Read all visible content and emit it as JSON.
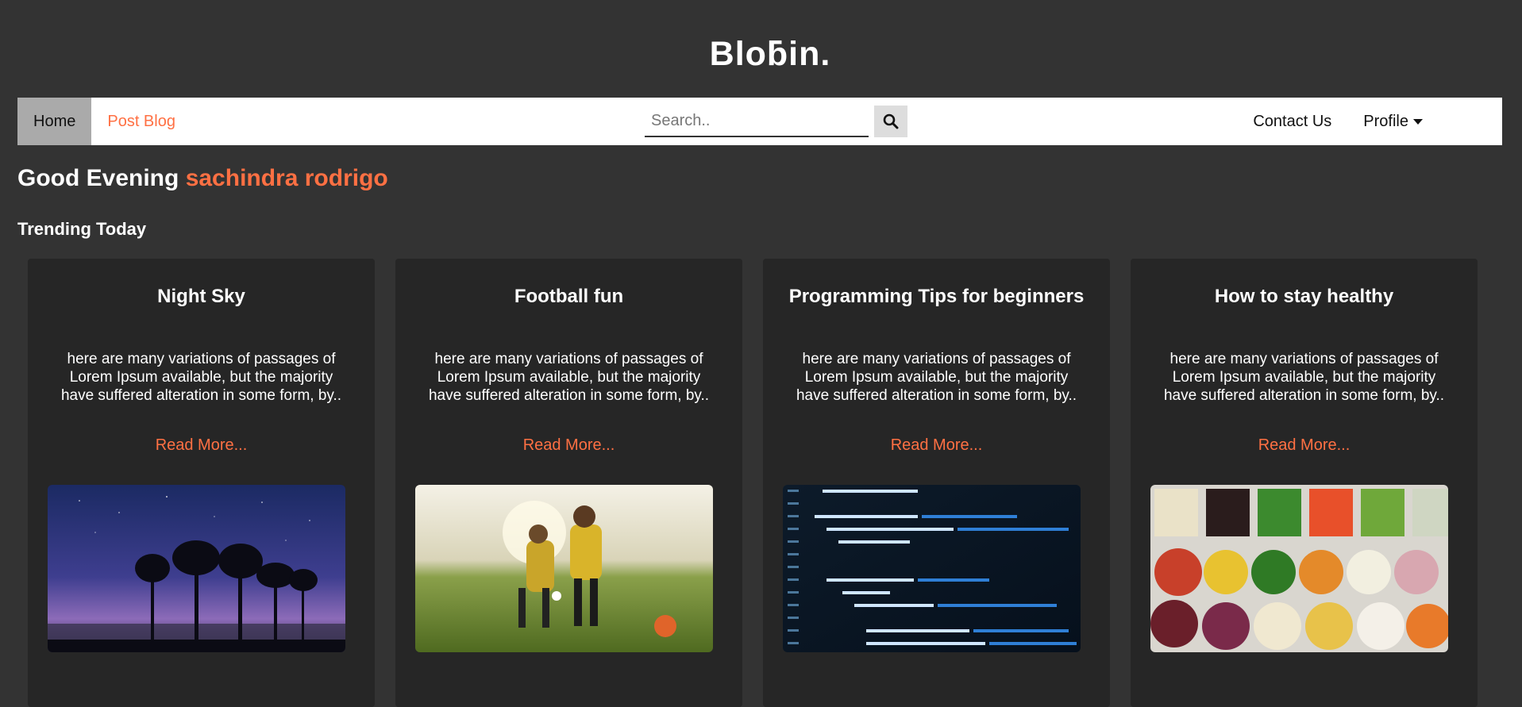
{
  "brand": {
    "logo": "Bloƃin."
  },
  "nav": {
    "home": "Home",
    "post_blog": "Post Blog",
    "contact": "Contact Us",
    "profile": "Profile"
  },
  "search": {
    "placeholder": "Search..",
    "value": ""
  },
  "greeting": {
    "prefix": "Good Evening",
    "user": "sachindra rodrigo"
  },
  "trending": {
    "title": "Trending Today",
    "cards": [
      {
        "title": "Night Sky",
        "excerpt": "here are many variations of passages of Lorem Ipsum available, but the majority have suffered alteration in some form, by..",
        "link": "Read More...",
        "image": "night-sky-trees"
      },
      {
        "title": "Football fun",
        "excerpt": "here are many variations of passages of Lorem Ipsum available, but the majority have suffered alteration in some form, by..",
        "link": "Read More...",
        "image": "kids-playing-football"
      },
      {
        "title": "Programming Tips for beginners",
        "excerpt": "here are many variations of passages of Lorem Ipsum available, but the majority have suffered alteration in some form, by..",
        "link": "Read More...",
        "image": "code-on-screen"
      },
      {
        "title": "How to stay healthy",
        "excerpt": "here are many variations of passages of Lorem Ipsum available, but the majority have suffered alteration in some form, by..",
        "link": "Read More...",
        "image": "vegetable-bowls"
      }
    ]
  },
  "colors": {
    "accent": "#ff7043",
    "background": "#333333",
    "card": "#262626",
    "nav_bg": "#ffffff",
    "nav_active": "#aaaaaa"
  }
}
